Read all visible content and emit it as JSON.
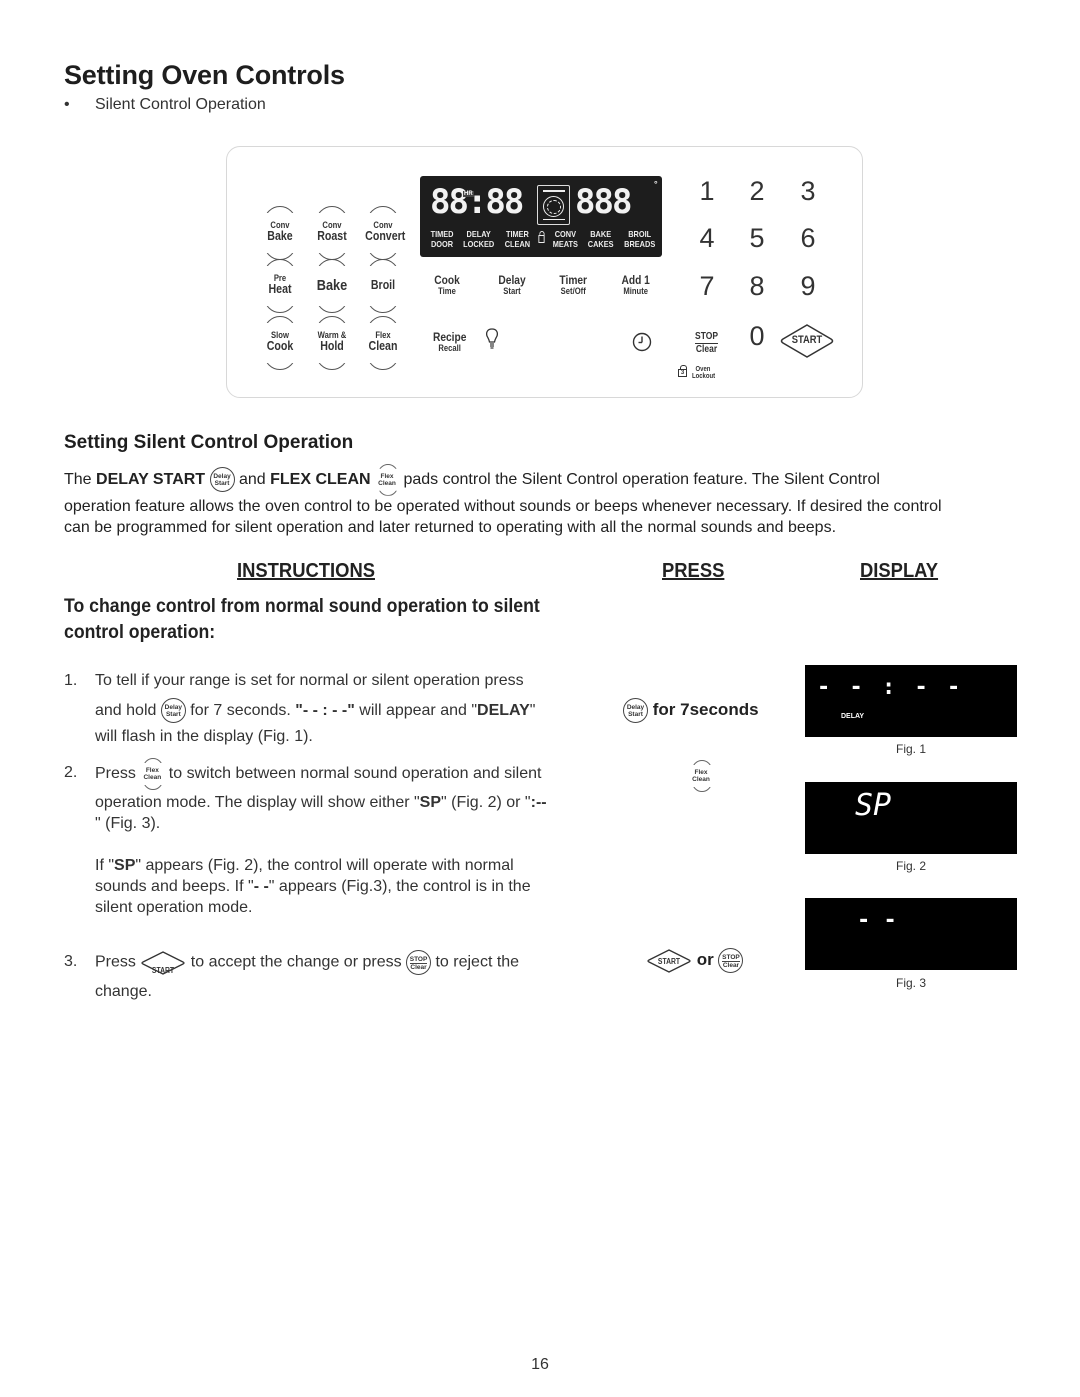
{
  "page": {
    "title": "Setting Oven Controls",
    "bullet": "Silent Control Operation",
    "page_number": "16"
  },
  "panel": {
    "mode_pads": [
      {
        "top": "Conv",
        "main": "Bake"
      },
      {
        "top": "Conv",
        "main": "Roast"
      },
      {
        "top": "Conv",
        "main": "Convert"
      },
      {
        "top": "Pre",
        "main": "Heat"
      },
      {
        "top": "",
        "main": "Bake"
      },
      {
        "top": "",
        "main": "Broil"
      },
      {
        "top": "Slow",
        "main": "Cook"
      },
      {
        "top": "Warm &",
        "main": "Hold"
      },
      {
        "top": "Flex",
        "main": "Clean"
      }
    ],
    "display": {
      "clock_digits": "88:88",
      "hr_tag": "HR",
      "temp_digits": "888",
      "degree": "°",
      "labels": [
        {
          "line1": "TIMED",
          "line2": "DOOR"
        },
        {
          "line1": "DELAY",
          "line2": "LOCKED"
        },
        {
          "line1": "TIMER",
          "line2": "CLEAN"
        },
        {
          "line1": "CONV",
          "line2": "MEATS"
        },
        {
          "line1": "BAKE",
          "line2": "CAKES"
        },
        {
          "line1": "BROIL",
          "line2": "BREADS"
        }
      ]
    },
    "function_pads": [
      {
        "line1": "Cook",
        "line2": "Time"
      },
      {
        "line1": "Delay",
        "line2": "Start"
      },
      {
        "line1": "Timer",
        "line2": "Set/Off"
      },
      {
        "line1": "Add 1",
        "line2": "Minute"
      },
      {
        "line1": "Recipe",
        "line2": "Recall"
      }
    ],
    "light_icon": "light-bulb-icon",
    "clock_icon": "clock-icon",
    "keypad": [
      "1",
      "2",
      "3",
      "4",
      "5",
      "6",
      "7",
      "8",
      "9",
      "0"
    ],
    "stop_clear": {
      "line1": "STOP",
      "line2": "Clear"
    },
    "start_label": "START",
    "lockout": {
      "key": "3",
      "line1": "Oven",
      "line2": "Lockout"
    }
  },
  "section": {
    "heading": "Setting Silent Control Operation",
    "intro_part1": "The ",
    "intro_bold1": "DELAY START",
    "intro_part2": " and ",
    "intro_bold2": "FLEX CLEAN",
    "intro_part3": " pads control the Silent Control operation feature. The Silent Control",
    "intro_line2": "operation feature allows the oven control to be operated without sounds or beeps whenever necessary. If desired the control",
    "intro_line3": "can be programmed for silent operation and later returned to operating with all the normal sounds and beeps."
  },
  "inline_pads": {
    "delay": {
      "line1": "Delay",
      "line2": "Start"
    },
    "flex": {
      "line1": "Flex",
      "line2": "Clean"
    },
    "start": "START",
    "stop": {
      "line1": "STOP",
      "line2": "Clear"
    }
  },
  "columns": {
    "instructions": "INSTRUCTIONS",
    "press": "PRESS",
    "display": "DISPLAY"
  },
  "subheading": "To change control from normal sound operation to silent control operation:",
  "steps": [
    {
      "num": "1.",
      "line1": "To tell if your range is set for normal or silent operation press",
      "line2a": "and hold ",
      "line2b": " for 7 seconds. ",
      "line2c": "\"- - : - -\"",
      "line2d": " will appear and \"",
      "line2e": "DELAY",
      "line2f": "\"",
      "line3": "will flash in the display (Fig. 1)."
    },
    {
      "num": "2.",
      "line1a": "Press ",
      "line1b": " to switch between normal sound operation and silent",
      "line2a": "operation mode. The display will show either \"",
      "line2b": "SP",
      "line2c": "\" (Fig. 2) or \"",
      "line2d": ":--",
      "line3": "\" (Fig. 3).",
      "note_a": "If \"",
      "note_b": "SP",
      "note_c": "\" appears (Fig. 2), the control will operate with normal",
      "note_line2a": "sounds and beeps.  If  \"",
      "note_line2b": "- -",
      "note_line2c": "\" appears (Fig.3), the control is in the",
      "note_line3": "silent operation mode."
    },
    {
      "num": "3.",
      "line1a": "Press ",
      "line1b": " to accept the change or press ",
      "line1c": " to reject the",
      "line2": "change."
    }
  ],
  "press_column": {
    "step1_text": "for 7seconds",
    "step3_or": "or"
  },
  "figures": [
    {
      "caption": "Fig. 1",
      "text": "- - : - -",
      "sub": "DELAY"
    },
    {
      "caption": "Fig. 2",
      "text": "SP"
    },
    {
      "caption": "Fig. 3",
      "text": "- -"
    }
  ]
}
